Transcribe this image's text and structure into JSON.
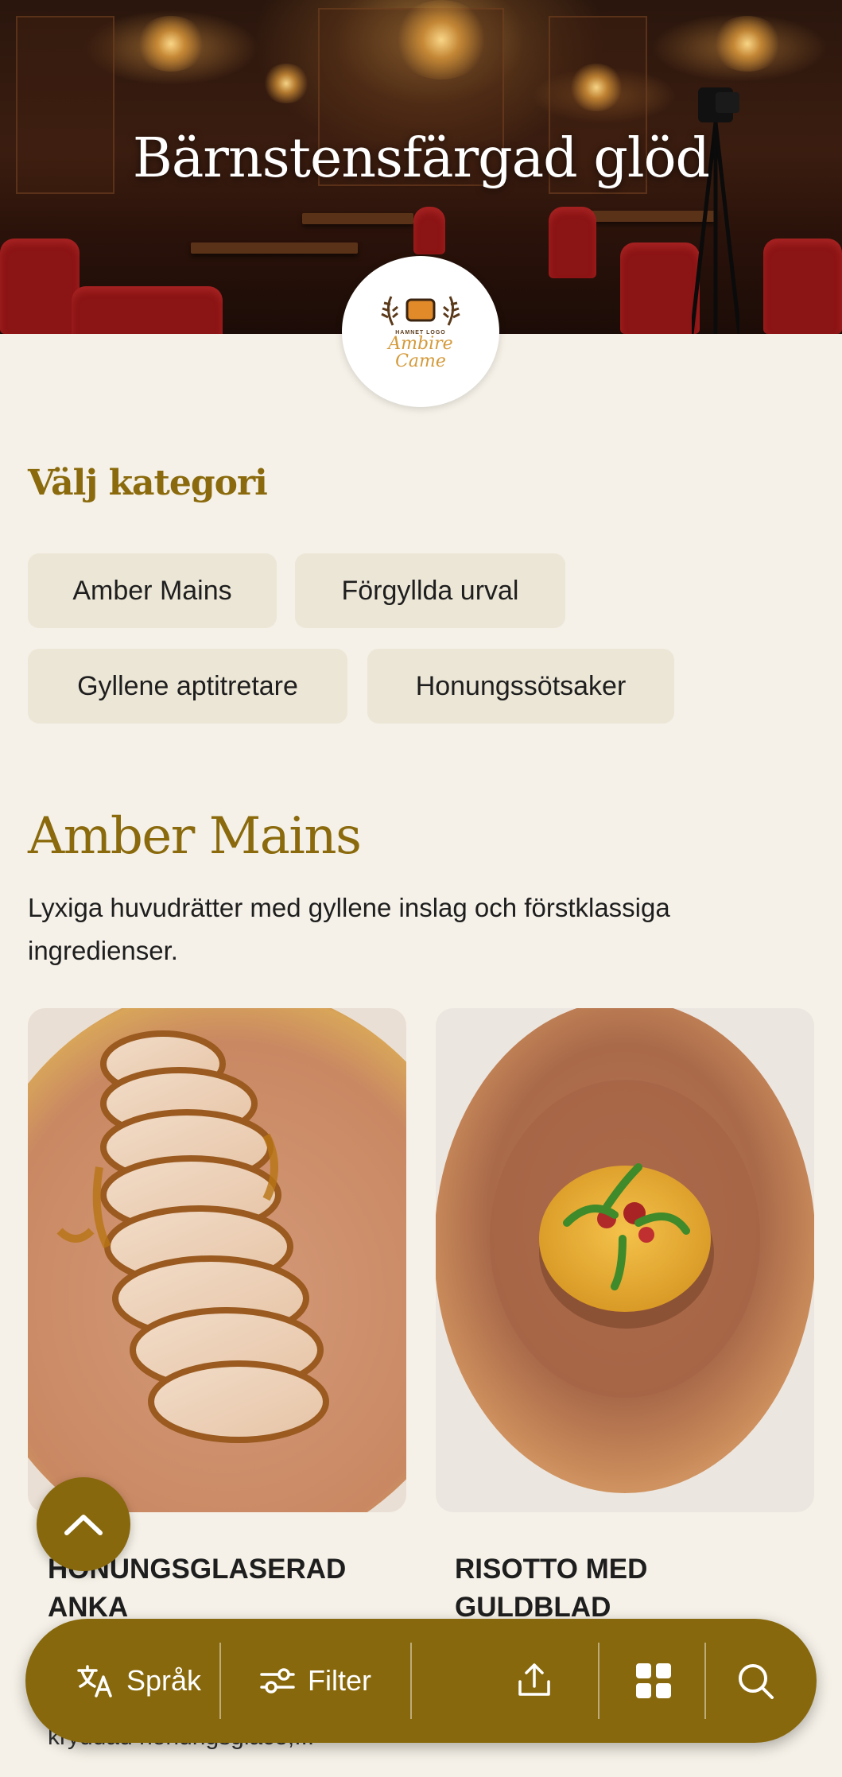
{
  "hero": {
    "title": "Bärnstensfärgad glöd"
  },
  "logo": {
    "small_text": "HAMNET LOGO",
    "script_text_line1": "Ambire",
    "script_text_line2": "Came"
  },
  "categories": {
    "heading": "Välj kategori",
    "items": [
      {
        "label": "Amber Mains"
      },
      {
        "label": "Förgyllda urval"
      },
      {
        "label": "Gyllene aptitretare"
      },
      {
        "label": "Honungssötsaker"
      }
    ]
  },
  "section": {
    "title": "Amber Mains",
    "description": "Lyxiga huvudrätter med gyllene inslag och förstklassiga ingredienser."
  },
  "dishes": [
    {
      "title": "HONUNGSGLASERAD ANKA",
      "description": "kryddad honungsglace,..."
    },
    {
      "title": "RISOTTO MED GULDBLAD",
      "description": ""
    }
  ],
  "bottom_bar": {
    "language_label": "Språk",
    "filter_label": "Filter",
    "share_icon": "share-icon",
    "grid_icon": "grid-icon",
    "search_icon": "search-icon"
  },
  "colors": {
    "accent": "#88680c",
    "heading": "#8a6a0c",
    "background": "#f5f1e8",
    "chip": "#ece6d6"
  }
}
